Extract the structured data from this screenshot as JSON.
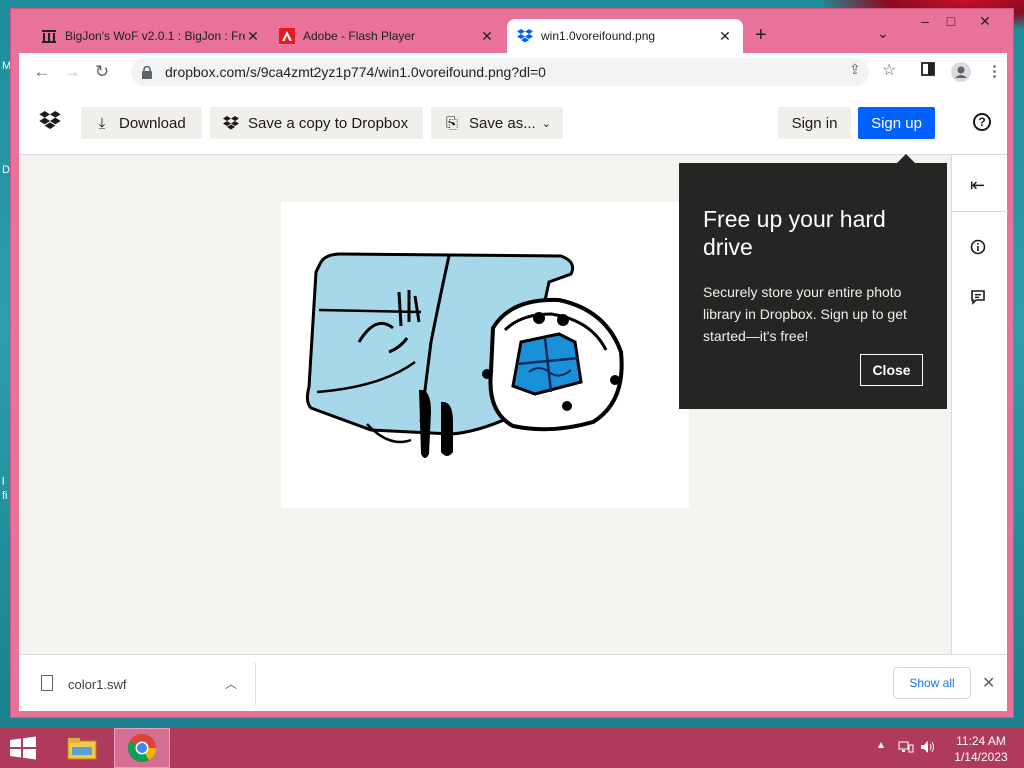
{
  "desktop": {
    "fragments": [
      "M",
      "D",
      "l",
      "fi"
    ]
  },
  "browser": {
    "tabs": [
      {
        "title": "BigJon's WoF v2.0.1 : BigJon : Fre",
        "icon": "archive-icon",
        "active": false
      },
      {
        "title": "Adobe - Flash Player",
        "icon": "adobe-icon",
        "active": false
      },
      {
        "title": "win1.0voreifound.png",
        "icon": "dropbox-icon",
        "active": true
      }
    ],
    "new_tab": "+",
    "tab_search": "⌄",
    "window_controls": {
      "minimize": "–",
      "maximize": "□",
      "close": "✕"
    },
    "url": "dropbox.com/s/9ca4zmt2yz1p774/win1.0voreifound.png?dl=0"
  },
  "dropbox": {
    "download_label": "Download",
    "save_copy_label": "Save a copy to Dropbox",
    "save_as_label": "Save as...",
    "sign_in_label": "Sign in",
    "sign_up_label": "Sign up",
    "brand_color": "#0061fe"
  },
  "popover": {
    "title": "Free up your hard drive",
    "body": "Securely store your entire photo library in Dropbox. Sign up to get started—it's free!",
    "close_label": "Close"
  },
  "downloads": {
    "file_name": "color1.swf",
    "show_all_label": "Show all"
  },
  "taskbar": {
    "time": "11:24 AM",
    "date": "1/14/2023"
  }
}
